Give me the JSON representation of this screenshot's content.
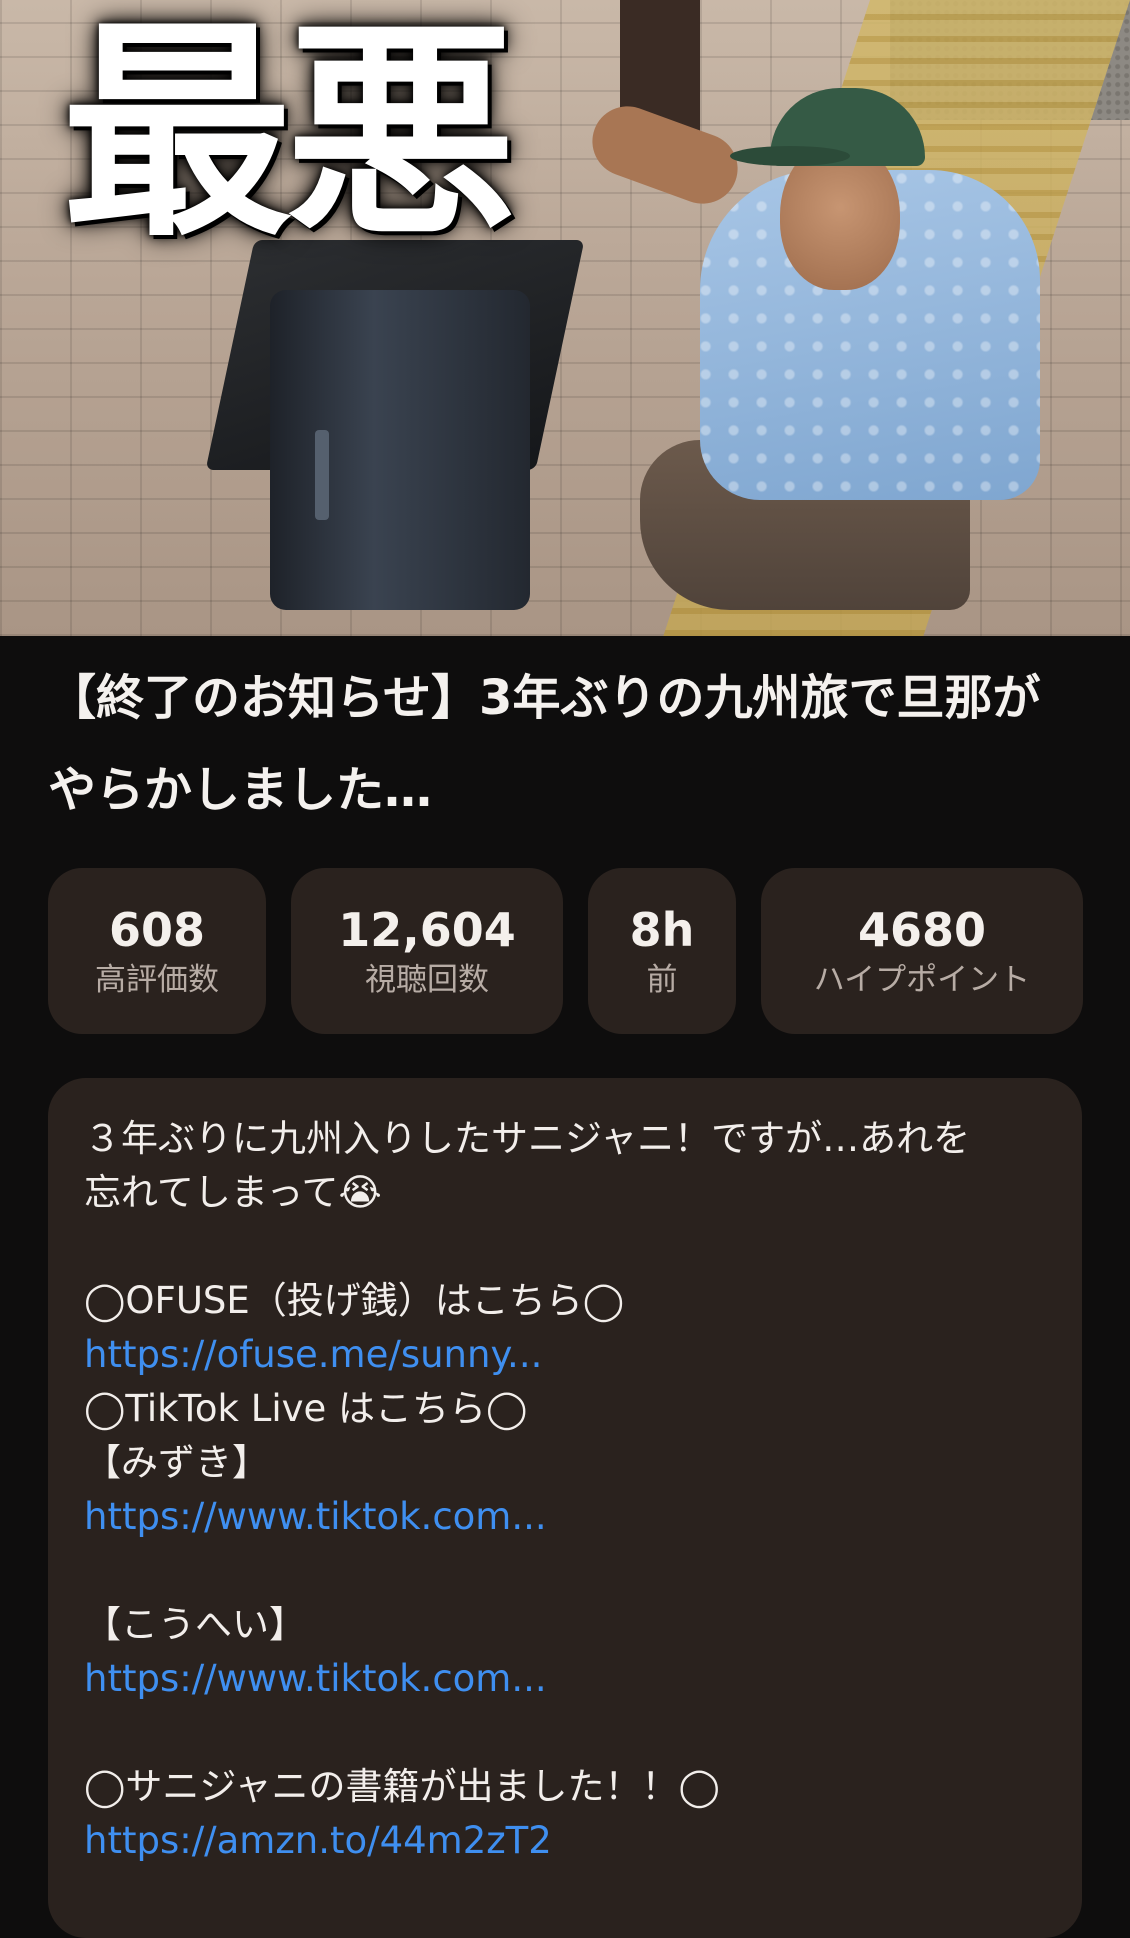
{
  "thumbnail": {
    "overlay_text": "最悪"
  },
  "video": {
    "title": "【終了のお知らせ】3年ぶりの九州旅で旦那がやらかしました…"
  },
  "stats": [
    {
      "value": "608",
      "label": "高評価数"
    },
    {
      "value": "12,604",
      "label": "視聴回数"
    },
    {
      "value": "8h",
      "label": "前"
    },
    {
      "value": "4680",
      "label": "ハイプポイント"
    }
  ],
  "description": {
    "intro_1": "３年ぶりに九州入りしたサニジャニ！ですが…あれを",
    "intro_2": "忘れてしまって😭",
    "ofuse_heading": "◯OFUSE（投げ銭）はこちら◯",
    "ofuse_link": "https://ofuse.me/sunny...",
    "tiktok_heading": "◯TikTok Live はこちら◯",
    "mizuki_label": "【みずき】",
    "mizuki_link": "https://www.tiktok.com...",
    "kouhei_label": "【こうへい】",
    "kouhei_link": "https://www.tiktok.com...",
    "book_heading": "◯サニジャニの書籍が出ました！！◯",
    "book_link": "https://amzn.to/44m2zT2"
  },
  "colors": {
    "background": "#0e0d0d",
    "card": "#2a221e",
    "link": "#3f8ff0"
  }
}
